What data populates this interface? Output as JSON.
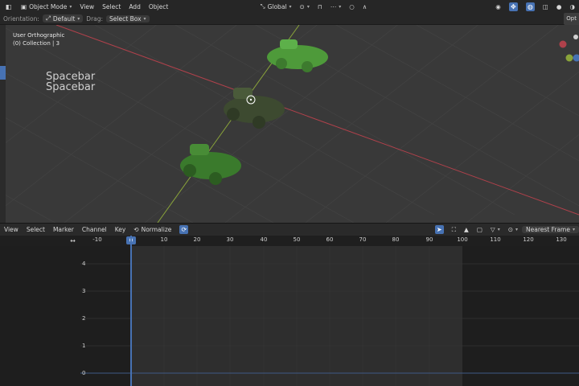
{
  "header": {
    "mode": "Object Mode",
    "menu": [
      "View",
      "Select",
      "Add",
      "Object"
    ],
    "transform_orientation": "Global"
  },
  "tool_header": {
    "orientation_label": "Orientation:",
    "orientation_value": "Default",
    "drag_label": "Drag:",
    "drag_value": "Select Box"
  },
  "viewport": {
    "view_name": "User Orthographic",
    "collection": "(0) Collection | 3",
    "key_overlay": [
      "Spacebar",
      "Spacebar"
    ],
    "options_label": "Opt",
    "colors": {
      "background": "#393939",
      "x_axis": "#b0414b",
      "y_axis": "#8aa43a",
      "car": "#4a8f3a"
    }
  },
  "graph_editor": {
    "menu": [
      "View",
      "Select",
      "Marker",
      "Channel",
      "Key"
    ],
    "normalize_label": "Normalize",
    "snap_mode": "Nearest Frame",
    "current_frame": "0",
    "ruler_ticks": [
      "-10",
      "10",
      "20",
      "30",
      "40",
      "50",
      "60",
      "70",
      "80",
      "90",
      "100",
      "110",
      "120",
      "130"
    ],
    "y_labels": [
      "4",
      "3",
      "2",
      "1",
      "0"
    ]
  }
}
